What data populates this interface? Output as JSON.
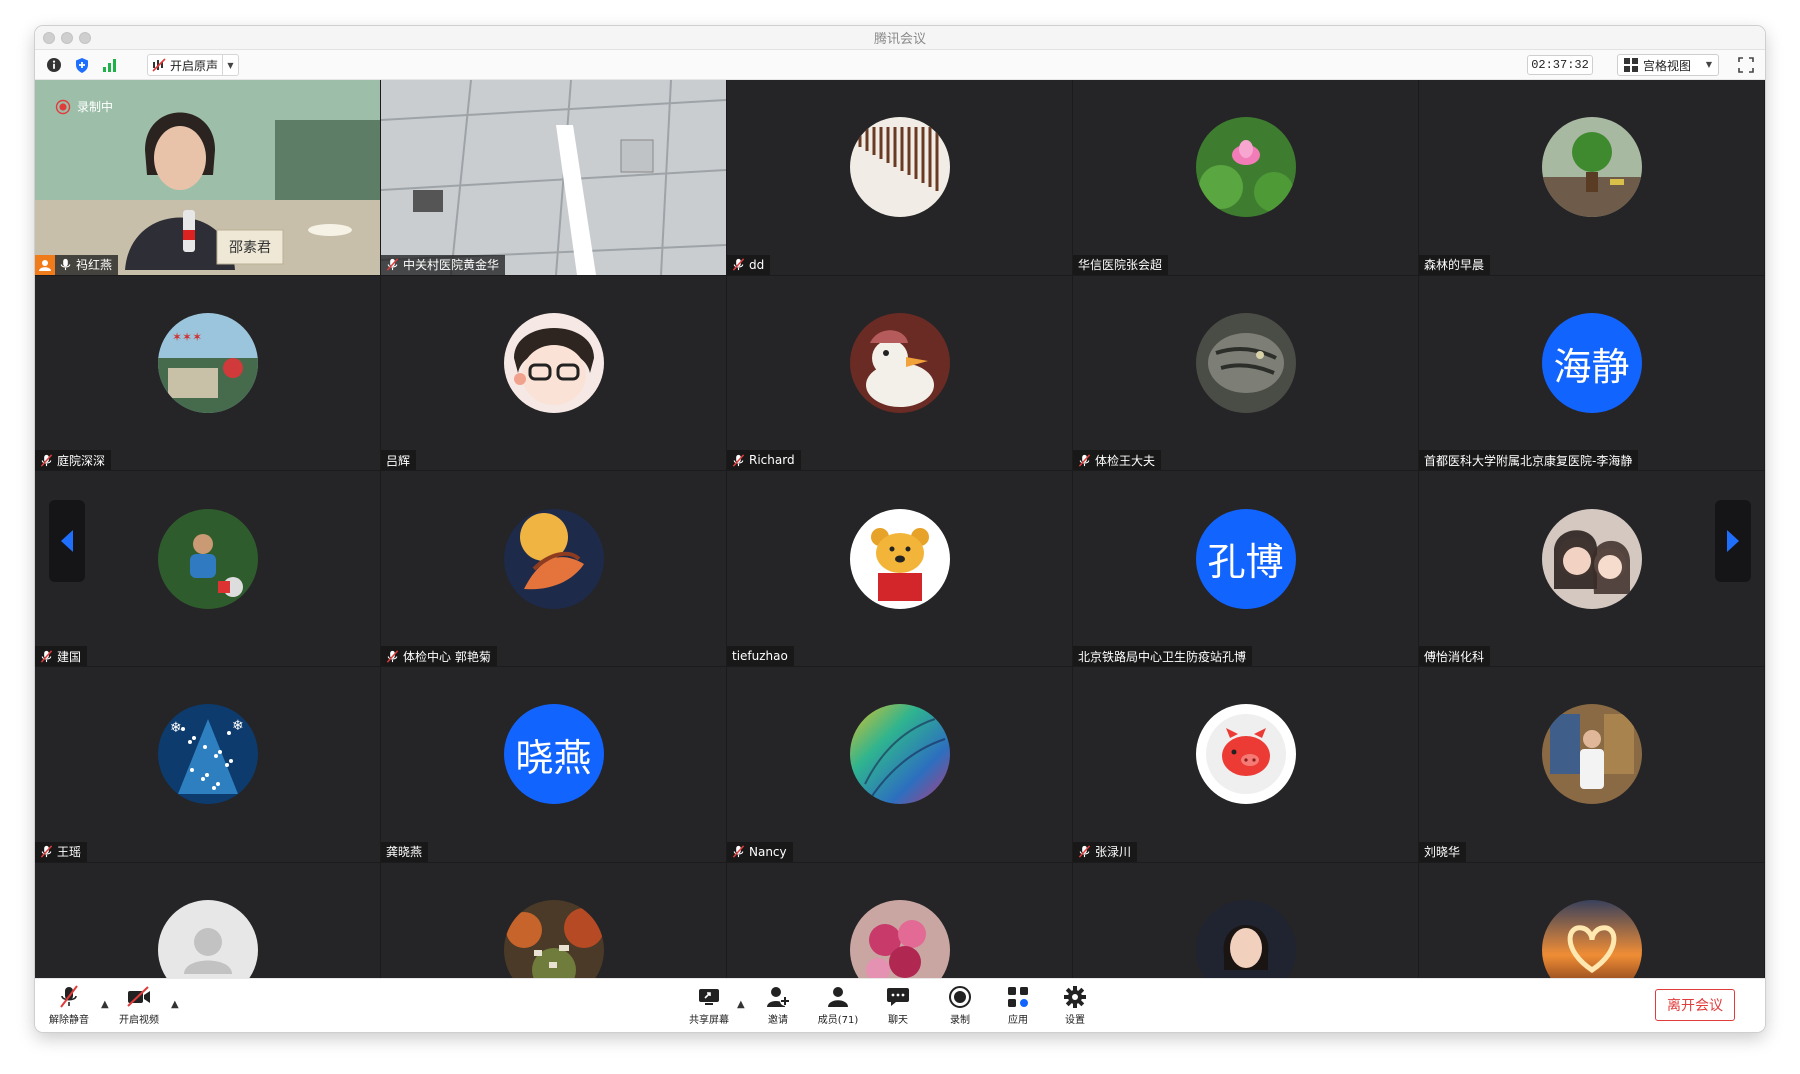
{
  "window": {
    "title": "腾讯会议"
  },
  "toolbar": {
    "audio_label": "开启原声",
    "timer": "02:37:32",
    "view_label": "宫格视图"
  },
  "participants": [
    {
      "name": "祃红燕",
      "recording_label": "录制中",
      "nameplate": "邵素君",
      "kind": "video-woman"
    },
    {
      "name": "中关村医院黄金华",
      "kind": "video-ceiling"
    },
    {
      "name": "dd",
      "kind": "photo",
      "icon": "matches-icon"
    },
    {
      "name": "华信医院张会超",
      "kind": "photo",
      "icon": "lotus-icon"
    },
    {
      "name": "森林的早晨",
      "kind": "photo",
      "icon": "plant-icon"
    },
    {
      "name": "庭院深深",
      "kind": "photo",
      "icon": "christmas-photo-icon"
    },
    {
      "name": "吕辉",
      "kind": "photo",
      "icon": "cartoon-face-icon"
    },
    {
      "name": "Richard",
      "kind": "photo",
      "icon": "duck-icon"
    },
    {
      "name": "体检王大夫",
      "kind": "photo",
      "icon": "cat-icon"
    },
    {
      "name": "首都医科大学附属北京康复医院-李海静",
      "kind": "text",
      "avatar_text": "海静"
    },
    {
      "name": "建国",
      "kind": "photo",
      "icon": "cyclist-icon"
    },
    {
      "name": "体检中心 郭艳菊",
      "kind": "photo",
      "icon": "hands-icon"
    },
    {
      "name": "tiefuzhao",
      "kind": "photo",
      "icon": "pooh-icon"
    },
    {
      "name": "北京铁路局中心卫生防疫站孔博",
      "kind": "text",
      "avatar_text": "孔博"
    },
    {
      "name": "傅怡消化科",
      "kind": "photo",
      "icon": "selfie-icon"
    },
    {
      "name": "王瑶",
      "kind": "photo",
      "icon": "tree-lights-icon"
    },
    {
      "name": "龚晓燕",
      "kind": "text",
      "avatar_text": "晓燕"
    },
    {
      "name": "Nancy",
      "kind": "photo",
      "icon": "feathers-icon"
    },
    {
      "name": "张渌川",
      "kind": "photo",
      "icon": "pig-icon"
    },
    {
      "name": "刘晓华",
      "kind": "photo",
      "icon": "doctor-office-icon"
    },
    {
      "name": "",
      "kind": "photo",
      "icon": "default-user-icon"
    },
    {
      "name": "",
      "kind": "photo",
      "icon": "autumn-village-icon"
    },
    {
      "name": "",
      "kind": "photo",
      "icon": "carnations-icon"
    },
    {
      "name": "",
      "kind": "photo",
      "icon": "woman-portrait-icon"
    },
    {
      "name": "",
      "kind": "photo",
      "icon": "sunset-heart-icon"
    }
  ],
  "bottom": {
    "unmute": "解除静音",
    "start_video": "开启视频",
    "share_screen": "共享屏幕",
    "invite": "邀请",
    "members": "成员(71)",
    "chat": "聊天",
    "record": "录制",
    "apps": "应用",
    "settings": "设置",
    "leave": "离开会议"
  },
  "colors": {
    "accent_blue": "#1264ff",
    "leave_red": "#e13c3c",
    "grid_bg": "#252527"
  }
}
